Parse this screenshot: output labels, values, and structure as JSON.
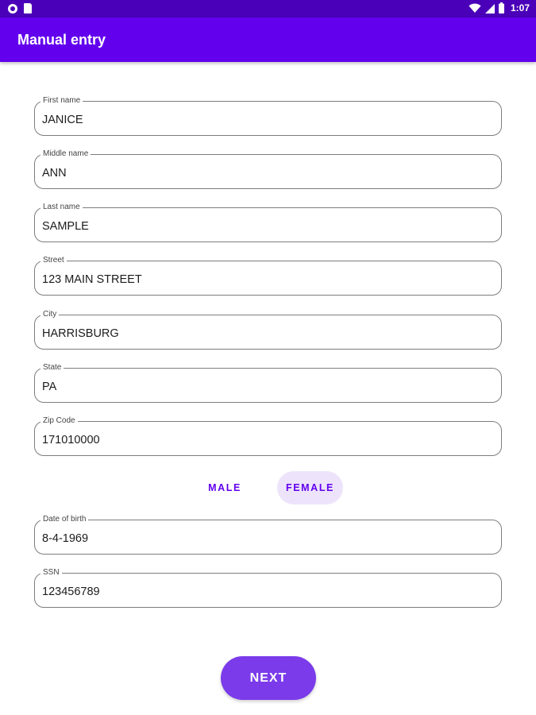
{
  "status_bar": {
    "time": "1:07",
    "icons": [
      "circle-notification-icon",
      "sd-card-icon",
      "wifi-icon",
      "signal-icon",
      "battery-icon"
    ]
  },
  "app_bar": {
    "title": "Manual entry"
  },
  "form": {
    "fields": [
      {
        "label": "First name",
        "value": "JANICE"
      },
      {
        "label": "Middle name",
        "value": "ANN"
      },
      {
        "label": "Last name",
        "value": "SAMPLE"
      },
      {
        "label": "Street",
        "value": "123 MAIN STREET"
      },
      {
        "label": "City",
        "value": "HARRISBURG"
      },
      {
        "label": "State",
        "value": "PA"
      },
      {
        "label": "Zip Code",
        "value": "171010000"
      }
    ],
    "gender": {
      "male_label": "MALE",
      "female_label": "FEMALE",
      "selected": "FEMALE"
    },
    "fields_after": [
      {
        "label": "Date of birth",
        "value": "8-4-1969"
      },
      {
        "label": "SSN",
        "value": "123456789"
      }
    ]
  },
  "next_label": "NEXT",
  "colors": {
    "primary": "#6200ee",
    "status_bar": "#4a00b8",
    "button": "#7b3bea",
    "selected_toggle_bg": "#ede4fb"
  }
}
